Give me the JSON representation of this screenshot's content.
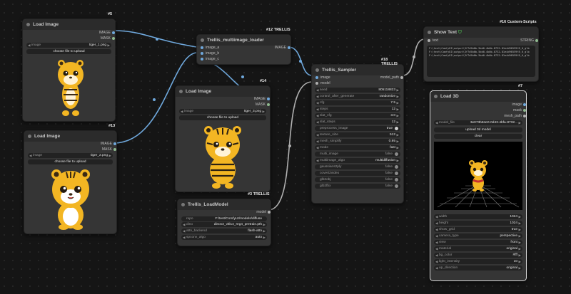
{
  "nodes": {
    "load1": {
      "id": "#5",
      "title": "Load Image",
      "outputs": [
        "IMAGE",
        "MASK"
      ],
      "image_label": "image",
      "image_value": "tiger_1.png",
      "upload_label": "choose file to upload"
    },
    "load2": {
      "id": "#13",
      "title": "Load Image",
      "outputs": [
        "IMAGE",
        "MASK"
      ],
      "image_label": "image",
      "image_value": "tiger_2.png",
      "upload_label": "choose file to upload"
    },
    "load3": {
      "id": "#14",
      "title": "Load Image",
      "outputs": [
        "IMAGE",
        "MASK"
      ],
      "image_label": "image",
      "image_value": "tiger_3.png",
      "upload_label": "choose file to upload"
    },
    "multi": {
      "id": "#12 TRELLIS",
      "title": "Trellis_multiimage_loader",
      "inputs": [
        "image_a",
        "image_b",
        "image_c"
      ],
      "output": "IMAGE"
    },
    "loadmodel": {
      "id": "#3 TRELLIS",
      "title": "Trellis_LoadModel",
      "output": "model",
      "widgets": [
        {
          "label": "repo",
          "value": "F:/test/ComfyUI/models/diffuse"
        },
        {
          "label": "dino",
          "value": "dinov2_vitl14_reg4_pretrain.pth"
        },
        {
          "label": "attn_backend",
          "value": "flash-attn"
        },
        {
          "label": "spconv_algo",
          "value": "auto"
        }
      ]
    },
    "sampler": {
      "id": "#18 TRELLIS",
      "title": "Trellis_Sampler",
      "inputs": [
        "image",
        "model"
      ],
      "output": "model_path",
      "widgets": [
        {
          "label": "seed",
          "value": "805118823"
        },
        {
          "label": "control_after_generate",
          "value": "randomize"
        },
        {
          "label": "cfg",
          "value": "7.5"
        },
        {
          "label": "steps",
          "value": "12"
        },
        {
          "label": "slat_cfg",
          "value": "3.0"
        },
        {
          "label": "slat_steps",
          "value": "12"
        },
        {
          "label": "preprocess_image",
          "value": "true"
        },
        {
          "label": "texture_size",
          "value": "512"
        },
        {
          "label": "mesh_simplify",
          "value": "0.95"
        },
        {
          "label": "mode",
          "value": "fast"
        },
        {
          "label": "multi_image",
          "value": "false"
        },
        {
          "label": "multiimage_algo",
          "value": "multidiffusion"
        },
        {
          "label": "gaussians2ply",
          "value": "false"
        },
        {
          "label": "covert2video",
          "value": "false"
        },
        {
          "label": "glb2obj",
          "value": "false"
        },
        {
          "label": "glb2fbx",
          "value": "false"
        }
      ]
    },
    "showtext": {
      "id": "#16 Custom-Scripts",
      "title": "Show Text",
      "input": "text",
      "output": "STRING",
      "lines": [
        "F:\\test\\ComfyUI\\output\\3f7d5b0b-5bd0-4b0b-8732-81e4d96559f8_0_glb",
        "F:\\test\\ComfyUI\\output\\3f7d5b0b-5bd0-4b0b-8732-81e4d96559f8_0_glb",
        "F:\\test\\ComfyUI\\output\\3f7d5b0b-5bd0-4b0b-8732-81e4d96559f8_0_glb"
      ]
    },
    "load3d": {
      "id": "#7",
      "title": "Load 3D",
      "outputs": [
        "image",
        "mask",
        "mesh_path"
      ],
      "model_file_label": "model_file",
      "model_file_value": "3e073b84e0-0d43-4bfa-8732...",
      "upload_label": "upload 3d model",
      "clear_label": "clear",
      "widgets": [
        {
          "label": "width",
          "value": "1024"
        },
        {
          "label": "height",
          "value": "1024"
        },
        {
          "label": "show_grid",
          "value": "true"
        },
        {
          "label": "camera_type",
          "value": "perspective"
        },
        {
          "label": "view",
          "value": "front"
        },
        {
          "label": "material",
          "value": "original"
        },
        {
          "label": "bg_color",
          "value": "#fff"
        },
        {
          "label": "light_intensity",
          "value": "10"
        },
        {
          "label": "up_direction",
          "value": "original"
        }
      ]
    }
  },
  "colors": {
    "canvas": "#151515",
    "node": "#353535",
    "wire_image": "#6fa8dc",
    "wire_model": "#b0b0b0",
    "tiger": "#f3b623"
  }
}
